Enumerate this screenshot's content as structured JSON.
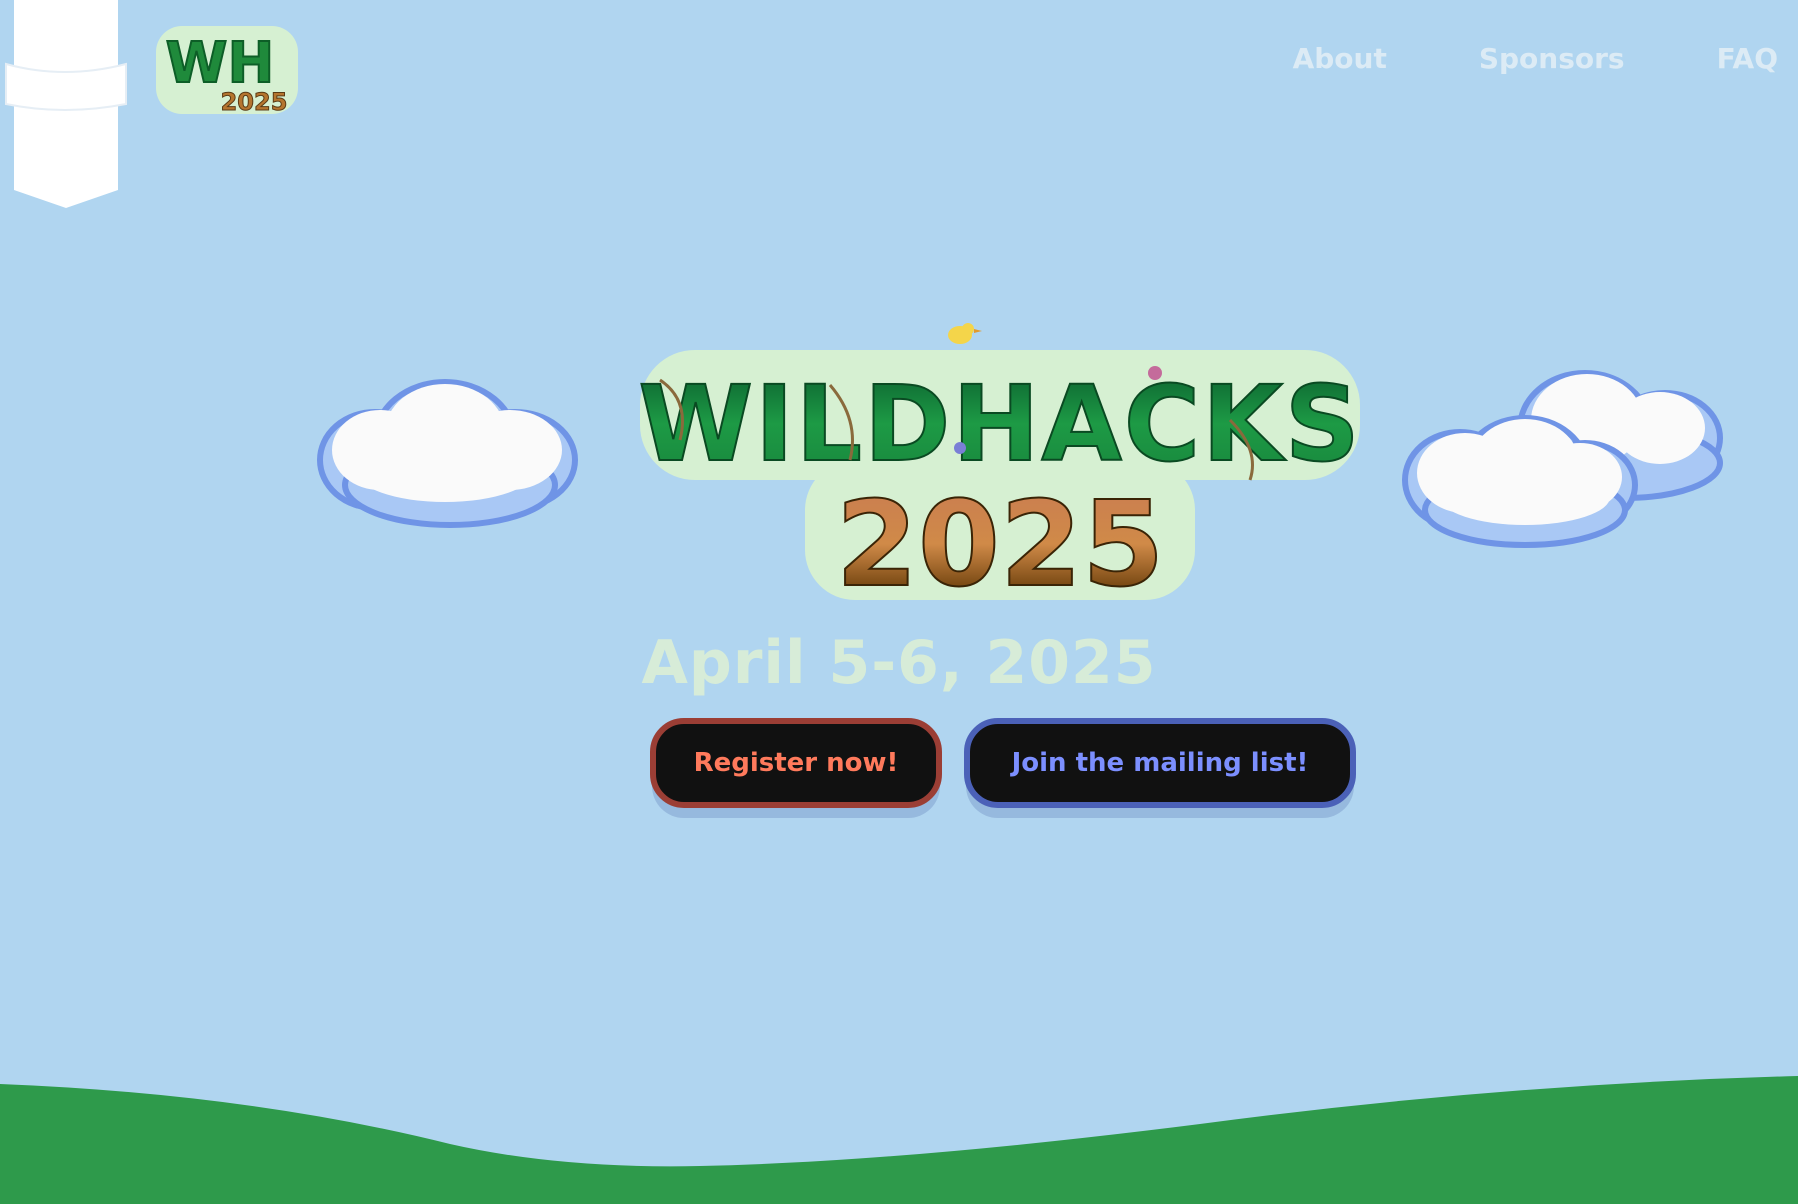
{
  "header": {
    "small_logo": {
      "top": "WH",
      "bottom": "2025"
    },
    "nav": [
      {
        "label": "About"
      },
      {
        "label": "Sponsors"
      },
      {
        "label": "FAQ"
      }
    ]
  },
  "hero": {
    "logo": {
      "top": "WILDHACKS",
      "bottom": "2025"
    },
    "date": "April 5-6, 2025",
    "register_label": "Register now!",
    "mailing_label": "Join the mailing list!"
  },
  "colors": {
    "sky": "#b0d5f0",
    "hill": "#2e9a4b",
    "register_border": "#9b3e35",
    "register_text": "#ff7a5c",
    "mailing_border": "#4b61b8",
    "mailing_text": "#7c8fff"
  }
}
